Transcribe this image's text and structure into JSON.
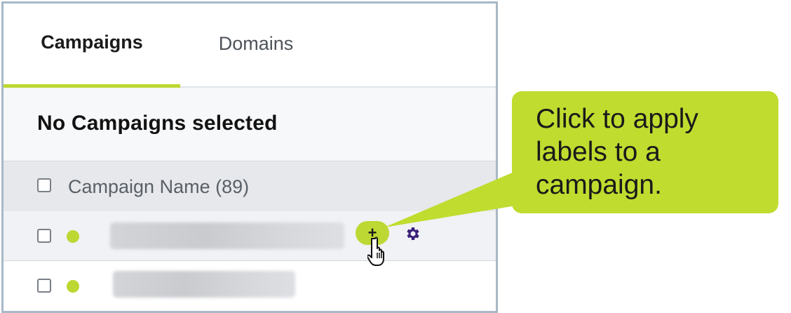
{
  "tabs": [
    {
      "label": "Campaigns",
      "active": true
    },
    {
      "label": "Domains",
      "active": false
    }
  ],
  "selection": {
    "title": "No Campaigns selected"
  },
  "table": {
    "column_header": "Campaign Name (89)",
    "rows": [
      {
        "status_color": "#bdd832",
        "name_blurred": true,
        "add_label_button": "+"
      },
      {
        "status_color": "#bdd832",
        "name_blurred": true
      }
    ]
  },
  "callout": {
    "text": "Click to apply labels to a campaign.",
    "color": "#c0dc2f"
  },
  "colors": {
    "accent": "#bdd832",
    "gear": "#3b1f7a"
  },
  "icons": [
    "add-label-icon",
    "gear-icon",
    "pointer-hand-icon"
  ]
}
